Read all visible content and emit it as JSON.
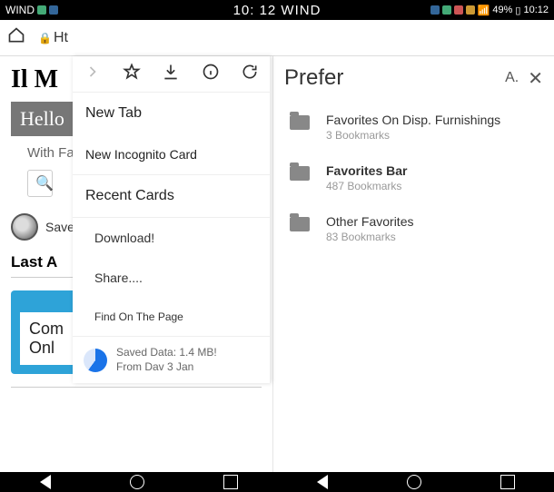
{
  "status_bar": {
    "carrier_left": "WIND",
    "clock_center": "10: 12 WIND",
    "battery": "49%",
    "clock_right": "10:12"
  },
  "chrome": {
    "url_fragment": "Ht"
  },
  "page": {
    "logo": "Il M",
    "hello": "Hello",
    "subtitle": "With Favorites",
    "author": "Save History",
    "last_heading": "Last A",
    "card_line1": "Com",
    "card_line2": "Onl"
  },
  "menu": {
    "new_tab": "New Tab",
    "incognito": "New Incognito Card",
    "recent": "Recent Cards",
    "download": "Download!",
    "share": "Share....",
    "find": "Find On The Page",
    "data_saved_line1": "Saved Data: 1.4 MB!",
    "data_saved_line2": "From Dav 3 Jan"
  },
  "panel": {
    "title": "Prefer",
    "aa": "A.",
    "folders": [
      {
        "name": "Favorites On Disp. Furnishings",
        "sub": "3 Bookmarks"
      },
      {
        "name": "Favorites Bar",
        "sub": "487 Bookmarks"
      },
      {
        "name": "Other Favorites",
        "sub": "83 Bookmarks"
      }
    ]
  }
}
